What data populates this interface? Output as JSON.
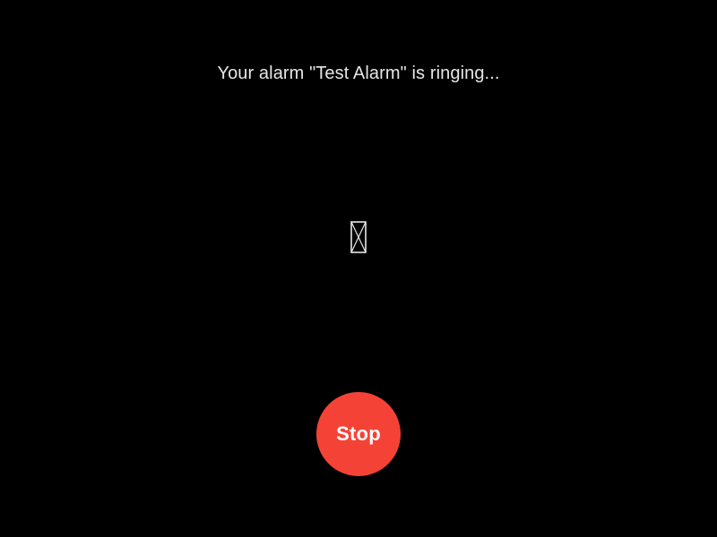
{
  "alarm": {
    "message": "Your alarm \"Test Alarm\" is ringing...",
    "icon": "missing-glyph-icon",
    "stop_label": "Stop"
  },
  "colors": {
    "background": "#000000",
    "text": "#e6e6e6",
    "stop_button": "#f44336",
    "stop_text": "#ffffff"
  }
}
